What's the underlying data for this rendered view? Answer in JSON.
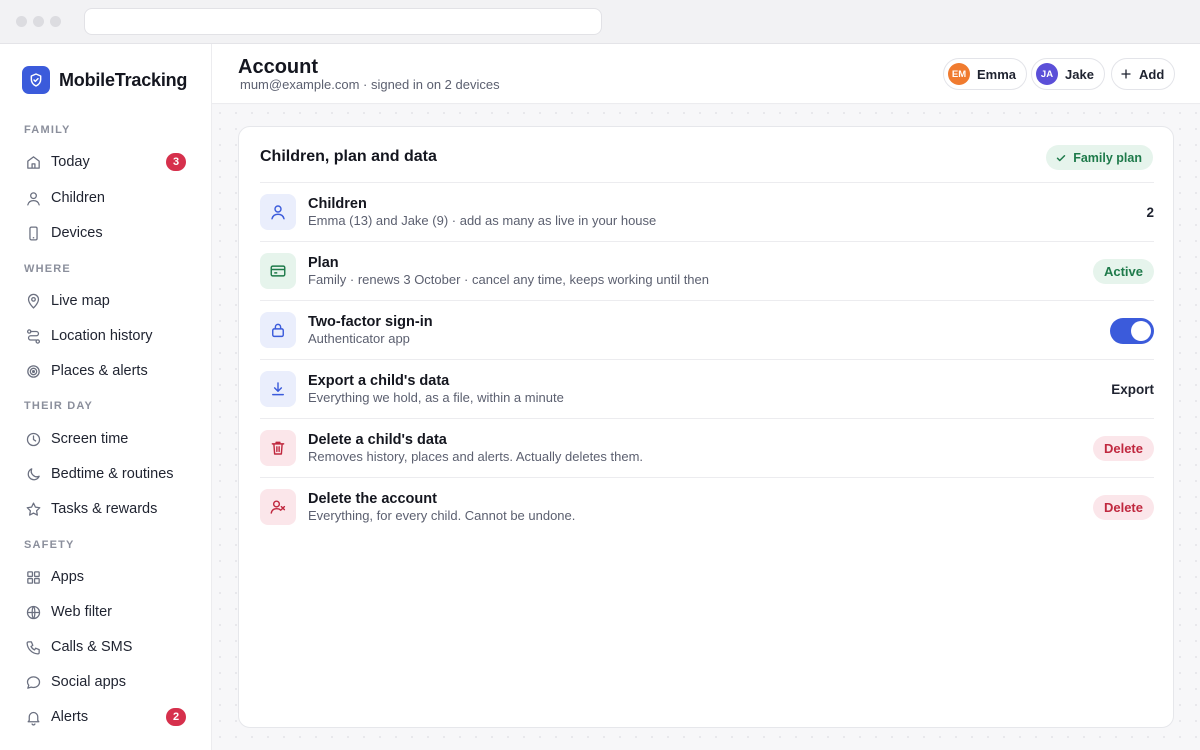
{
  "brand": {
    "name": "MobileTracking",
    "logo_icon": "shield-check-icon",
    "color": "#3b5bdb"
  },
  "sidebar": {
    "sections": [
      {
        "label": "FAMILY",
        "items": [
          {
            "label": "Today",
            "icon": "home-icon",
            "badge": "3"
          },
          {
            "label": "Children",
            "icon": "user-icon"
          },
          {
            "label": "Devices",
            "icon": "phone-icon"
          }
        ]
      },
      {
        "label": "WHERE",
        "items": [
          {
            "label": "Live map",
            "icon": "map-pin-icon"
          },
          {
            "label": "Location history",
            "icon": "route-icon"
          },
          {
            "label": "Places & alerts",
            "icon": "target-icon"
          }
        ]
      },
      {
        "label": "THEIR DAY",
        "items": [
          {
            "label": "Screen time",
            "icon": "clock-icon"
          },
          {
            "label": "Bedtime & routines",
            "icon": "moon-icon"
          },
          {
            "label": "Tasks & rewards",
            "icon": "star-icon"
          }
        ]
      },
      {
        "label": "SAFETY",
        "items": [
          {
            "label": "Apps",
            "icon": "grid-icon"
          },
          {
            "label": "Web filter",
            "icon": "globe-icon"
          },
          {
            "label": "Calls & SMS",
            "icon": "phone-call-icon"
          },
          {
            "label": "Social apps",
            "icon": "chat-bubble-icon"
          },
          {
            "label": "Alerts",
            "icon": "bell-icon",
            "badge": "2"
          }
        ]
      }
    ],
    "badge_color": "#d6304c"
  },
  "header": {
    "title": "Account",
    "subtitle": "mum@example.com · signed in on 2 devices",
    "children": [
      {
        "initials": "EM",
        "name": "Emma",
        "color": "#f07b2f"
      },
      {
        "initials": "JA",
        "name": "Jake",
        "color": "#5b4fd8"
      }
    ],
    "add_label": "Add"
  },
  "card": {
    "title": "Children, plan and data",
    "plan_badge": "Family plan",
    "rows": [
      {
        "icon": "user-icon",
        "title": "Children",
        "desc": "Emma (13) and Jake (9) · add as many as live in your house",
        "value": "2"
      },
      {
        "icon": "credit-card-icon",
        "title": "Plan",
        "desc": "Family · renews 3 October · cancel any time, keeps working until then",
        "status": "Active"
      },
      {
        "icon": "lock-icon",
        "title": "Two-factor sign-in",
        "desc": "Authenticator app",
        "toggle_on": true
      },
      {
        "icon": "download-icon",
        "title": "Export a child's data",
        "desc": "Everything we hold, as a file, within a minute",
        "action": "Export"
      },
      {
        "icon": "trash-icon",
        "title": "Delete a child's data",
        "desc": "Removes history, places and alerts. Actually deletes them.",
        "action": "Delete"
      },
      {
        "icon": "user-remove-icon",
        "title": "Delete the account",
        "desc": "Everything, for every child. Cannot be undone.",
        "action": "Delete"
      }
    ]
  },
  "colors": {
    "accent": "#3b5bdb",
    "success": "#1e7a4a",
    "danger": "#c0283f"
  }
}
